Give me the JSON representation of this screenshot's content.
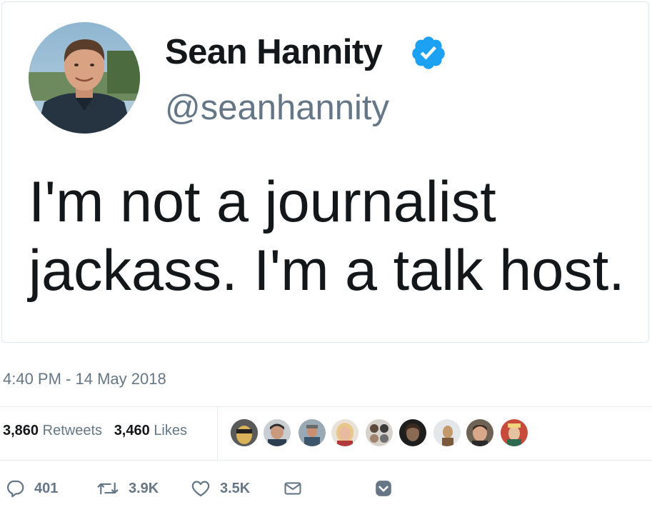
{
  "tweet": {
    "author": {
      "display_name": "Sean Hannity",
      "handle": "@seanhannity",
      "verified": true,
      "avatar_icon": "profile-photo-avatar"
    },
    "text_line1": "I'm not a journalist",
    "text_line2": "jackass. I'm a talk host.",
    "timestamp": "4:40 PM - 14 May 2018"
  },
  "stats": {
    "retweets_count": "3,860",
    "retweets_label": "Retweets",
    "likes_count": "3,460",
    "likes_label": "Likes",
    "liker_avatar_count": 9
  },
  "actions": {
    "reply_count": "401",
    "retweet_count": "3.9K",
    "like_count": "3.5K",
    "icons": [
      "reply-icon",
      "retweet-icon",
      "like-icon",
      "direct-message-icon",
      "more-chevron-icon"
    ]
  },
  "colors": {
    "text_primary": "#14171a",
    "text_secondary": "#657786",
    "verified_blue": "#1da1f2",
    "border": "#e6ecf0"
  }
}
